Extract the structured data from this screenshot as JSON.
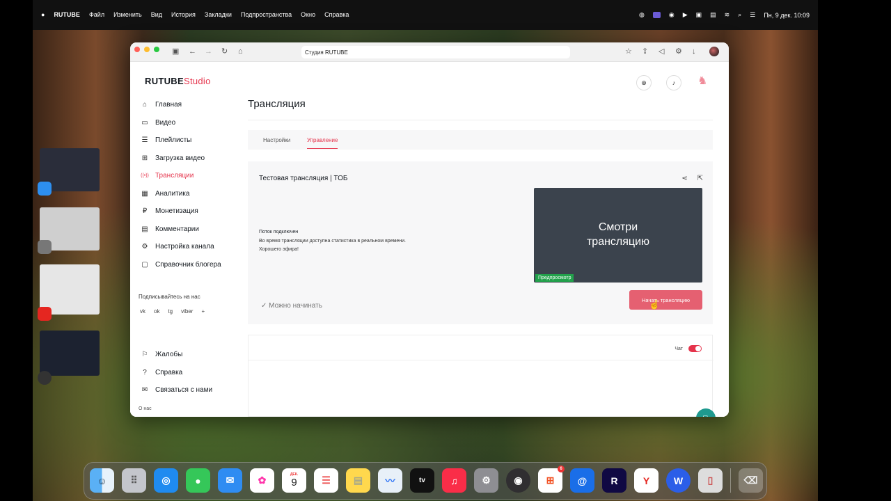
{
  "menubar": {
    "apple": "",
    "app_name": "RUTUBE",
    "menus": [
      "Файл",
      "Изменить",
      "Вид",
      "История",
      "Закладки",
      "Подпространства",
      "Окно",
      "Справка"
    ],
    "clock": "Пн, 9 дек. 10:09"
  },
  "browser": {
    "url": "Студия RUTUBE"
  },
  "logo": {
    "brand": "RUTUBE",
    "studio": "Studio"
  },
  "sidebar": {
    "items": [
      {
        "label": "Главная",
        "icon": "home-icon",
        "glyph": "⌂"
      },
      {
        "label": "Видео",
        "icon": "video-icon",
        "glyph": "▭"
      },
      {
        "label": "Плейлисты",
        "icon": "playlist-icon",
        "glyph": "☰"
      },
      {
        "label": "Загрузка видео",
        "icon": "upload-icon",
        "glyph": "⊞"
      },
      {
        "label": "Трансляции",
        "icon": "broadcast-icon",
        "glyph": "((•))"
      },
      {
        "label": "Аналитика",
        "icon": "analytics-icon",
        "glyph": "▦"
      },
      {
        "label": "Монетизация",
        "icon": "monetization-icon",
        "glyph": "₽"
      },
      {
        "label": "Комментарии",
        "icon": "comments-icon",
        "glyph": "▤"
      },
      {
        "label": "Настройка канала",
        "icon": "settings-icon",
        "glyph": "⚙"
      },
      {
        "label": "Справочник блогера",
        "icon": "guide-icon",
        "glyph": "▢"
      }
    ],
    "follow_label": "Подписывайтесь на нас",
    "socials": [
      "vk",
      "ok",
      "tg",
      "viber",
      "+"
    ],
    "bottom_items": [
      {
        "label": "Жалобы",
        "icon": "flag-icon",
        "glyph": "⚐"
      },
      {
        "label": "Справка",
        "icon": "help-icon",
        "glyph": "?"
      },
      {
        "label": "Связаться с нами",
        "icon": "mail-icon",
        "glyph": "✉"
      }
    ],
    "about": "О нас"
  },
  "main": {
    "title": "Трансляция",
    "tabs": [
      "Настройки",
      "Управление"
    ],
    "stream": {
      "title": "Тестовая трансляция | ТОБ",
      "status_title": "Поток подключен",
      "status_line1": "Во время трансляции доступна статистика в реальном времени.",
      "status_line2": "Хорошего эфира!",
      "preview_line1": "Смотри",
      "preview_line2": "трансляцию",
      "preview_badge": "Предпросмотр",
      "ready_label": "Можно начинать",
      "start_button": "Начать трансляцию"
    },
    "chat": {
      "label": "Чат",
      "enabled": true
    }
  },
  "dock": {
    "calendar_month": "ДЕК.",
    "calendar_day": "9",
    "badge": "6",
    "apps": [
      "finder",
      "launchpad",
      "safari",
      "messages",
      "mail",
      "photos",
      "calendar",
      "reminders",
      "notes",
      "freeform",
      "apple-tv",
      "music",
      "system-settings",
      "obs",
      "microsoft",
      "mail-ru",
      "rutube",
      "yandex",
      "word",
      "iphone-mirroring",
      "trash"
    ]
  },
  "colors": {
    "accent": "#e5334b",
    "start_button": "#e56071",
    "preview_bg": "#3b434d",
    "badge_green": "#22a14b",
    "fab": "#1f9a8f"
  }
}
